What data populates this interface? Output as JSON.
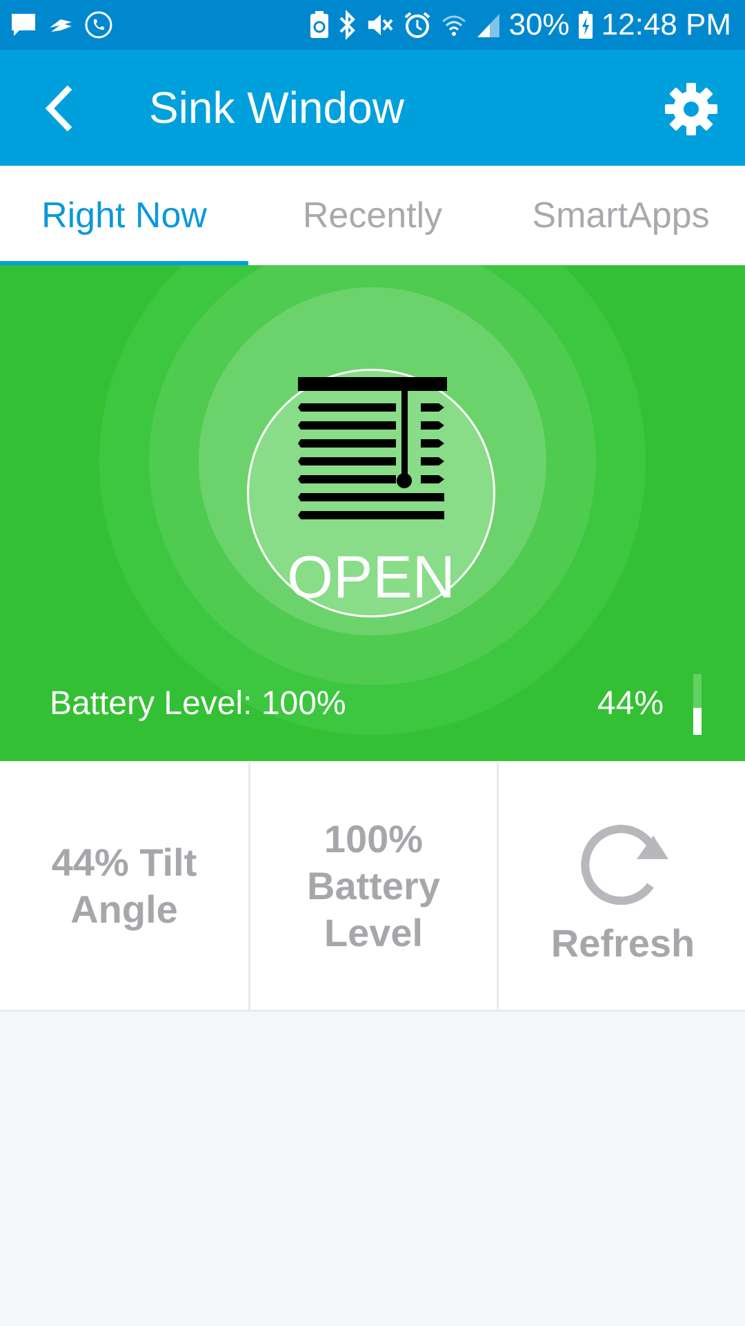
{
  "status_bar": {
    "battery_percent": "30%",
    "time": "12:48 PM",
    "left_icons": [
      "message-icon",
      "carrier-icon",
      "phone-call-icon"
    ],
    "right_icons": [
      "battery-saver-icon",
      "bluetooth-icon",
      "mute-icon",
      "alarm-icon",
      "wifi-icon",
      "signal-icon",
      "charging-battery-icon"
    ]
  },
  "app_bar": {
    "title": "Sink Window",
    "back_icon": "chevron-left-icon",
    "settings_icon": "gear-icon"
  },
  "tabs": [
    {
      "label": "Right Now",
      "active": true
    },
    {
      "label": "Recently",
      "active": false
    },
    {
      "label": "SmartApps",
      "active": false
    }
  ],
  "hero": {
    "state": "OPEN",
    "icon": "window-blinds-icon",
    "battery_text": "Battery Level: 100%",
    "level_text": "44%",
    "level_fraction": 0.44,
    "background_color": "#34c035"
  },
  "tiles": {
    "tilt": "44% Tilt Angle",
    "battery": "100% Battery Level",
    "refresh": "Refresh",
    "refresh_icon": "refresh-icon"
  },
  "colors": {
    "status_bar": "#0088cf",
    "app_bar": "#00a0dd",
    "active_tab": "#0b98d8",
    "inactive_text": "#a9a9ad"
  }
}
